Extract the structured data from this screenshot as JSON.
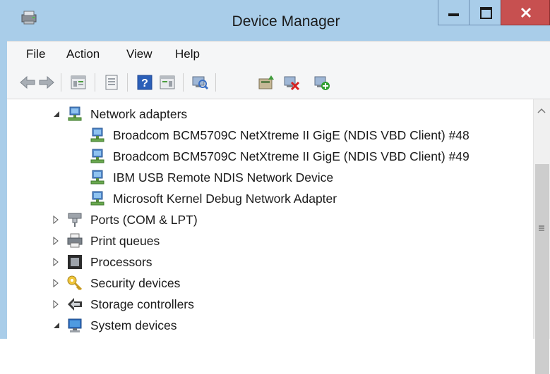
{
  "window": {
    "title": "Device Manager",
    "colors": {
      "titlebar": "#a9cde9",
      "close_button": "#c75050"
    }
  },
  "menu": [
    "File",
    "Action",
    "View",
    "Help"
  ],
  "toolbar": {
    "icons": [
      "back-arrow-icon",
      "forward-arrow-icon",
      "show-hide-console-tree-icon",
      "properties-icon",
      "help-icon",
      "action-pane-icon",
      "scan-hardware-icon",
      "update-driver-icon",
      "uninstall-device-icon",
      "add-legacy-hardware-icon"
    ]
  },
  "tree": {
    "network_adapters": {
      "label": "Network adapters",
      "children": [
        "Broadcom BCM5709C NetXtreme II GigE (NDIS VBD Client) #48",
        "Broadcom BCM5709C NetXtreme II GigE (NDIS VBD Client) #49",
        "IBM USB Remote NDIS Network Device",
        "Microsoft Kernel Debug Network Adapter"
      ]
    },
    "categories": [
      "Ports (COM & LPT)",
      "Print queues",
      "Processors",
      "Security devices",
      "Storage controllers",
      "System devices"
    ]
  }
}
